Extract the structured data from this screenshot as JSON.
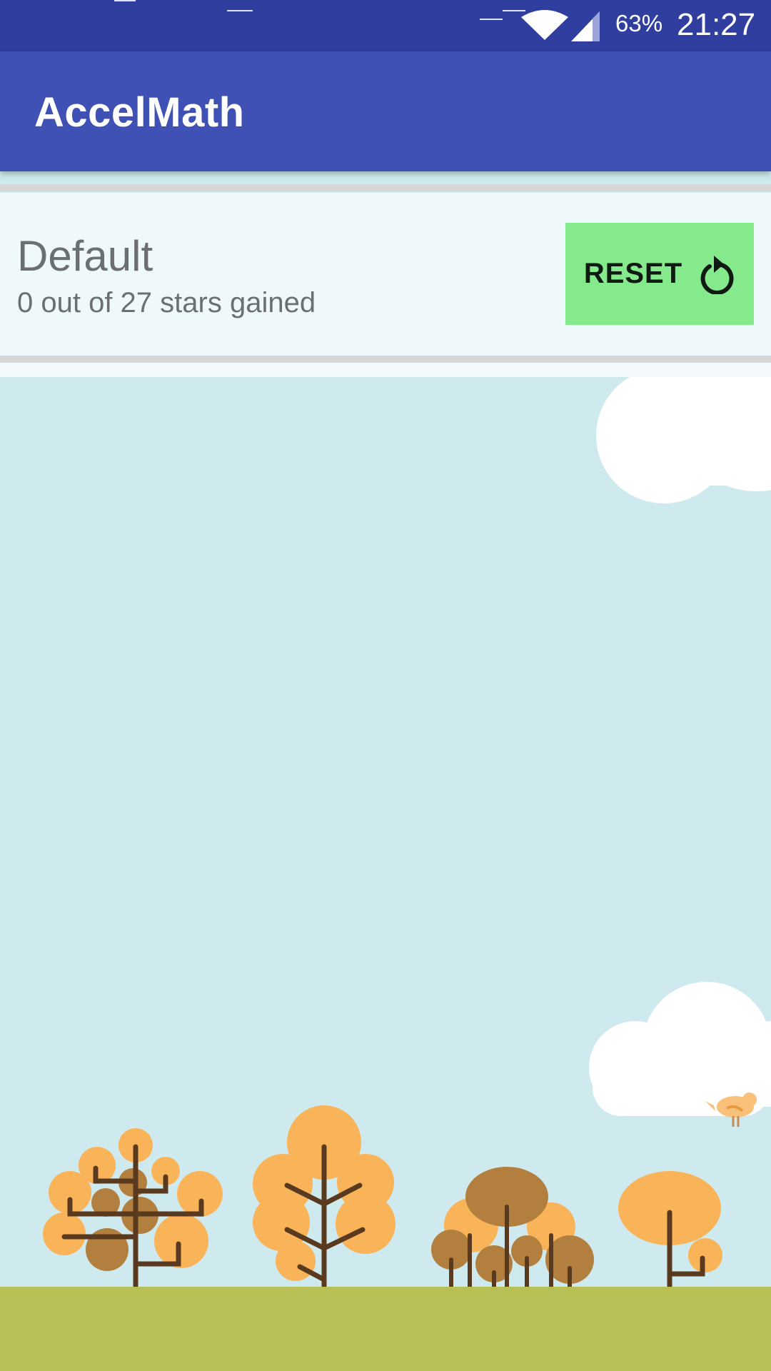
{
  "status_bar": {
    "battery": "63%",
    "time": "21:27",
    "icons": [
      "wifi-icon",
      "signal-icon"
    ]
  },
  "app_bar": {
    "title": "AccelMath"
  },
  "level_card": {
    "name": "Default",
    "stars_text": "0 out of 27 stars gained",
    "reset_label": "RESET",
    "reset_icon": "refresh-icon"
  },
  "colors": {
    "status_bar": "#303f9f",
    "app_bar": "#3f51b5",
    "reset_button": "#85ea8c",
    "sky": "#cfeaee",
    "ground": "#b8bf55",
    "foliage_light": "#f9b45a",
    "foliage_dark": "#b27f3e",
    "trunk": "#5a3a1f"
  }
}
